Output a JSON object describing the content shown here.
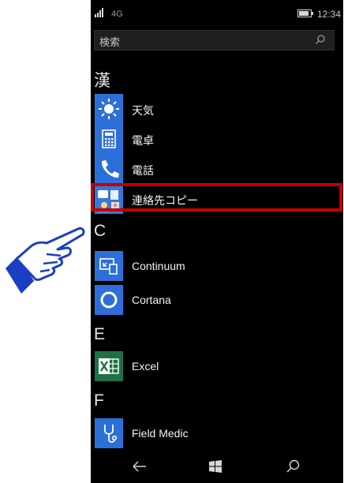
{
  "status_bar": {
    "network": "4G",
    "time": "12:34"
  },
  "search": {
    "placeholder": "検索"
  },
  "sections": [
    {
      "header": "漢",
      "apps": [
        {
          "label": "天気",
          "icon": "sun-icon"
        },
        {
          "label": "電卓",
          "icon": "calculator-icon"
        },
        {
          "label": "電話",
          "icon": "phone-icon"
        },
        {
          "label": "連絡先コピー",
          "icon": "contacts-copy-icon",
          "highlighted": true
        }
      ]
    },
    {
      "header": "C",
      "apps": [
        {
          "label": "Continuum",
          "icon": "continuum-icon"
        },
        {
          "label": "Cortana",
          "icon": "cortana-icon"
        }
      ]
    },
    {
      "header": "E",
      "apps": [
        {
          "label": "Excel",
          "icon": "excel-icon"
        }
      ]
    },
    {
      "header": "F",
      "apps": [
        {
          "label": "Field Medic",
          "icon": "stethoscope-icon"
        }
      ]
    }
  ],
  "nav": {
    "back": "back-icon",
    "start": "windows-start-icon",
    "search": "search-icon"
  },
  "colors": {
    "tile_blue": "#2d6fd9",
    "excel_green": "#1e7145",
    "highlight_red": "#c40000",
    "background": "#000000"
  }
}
